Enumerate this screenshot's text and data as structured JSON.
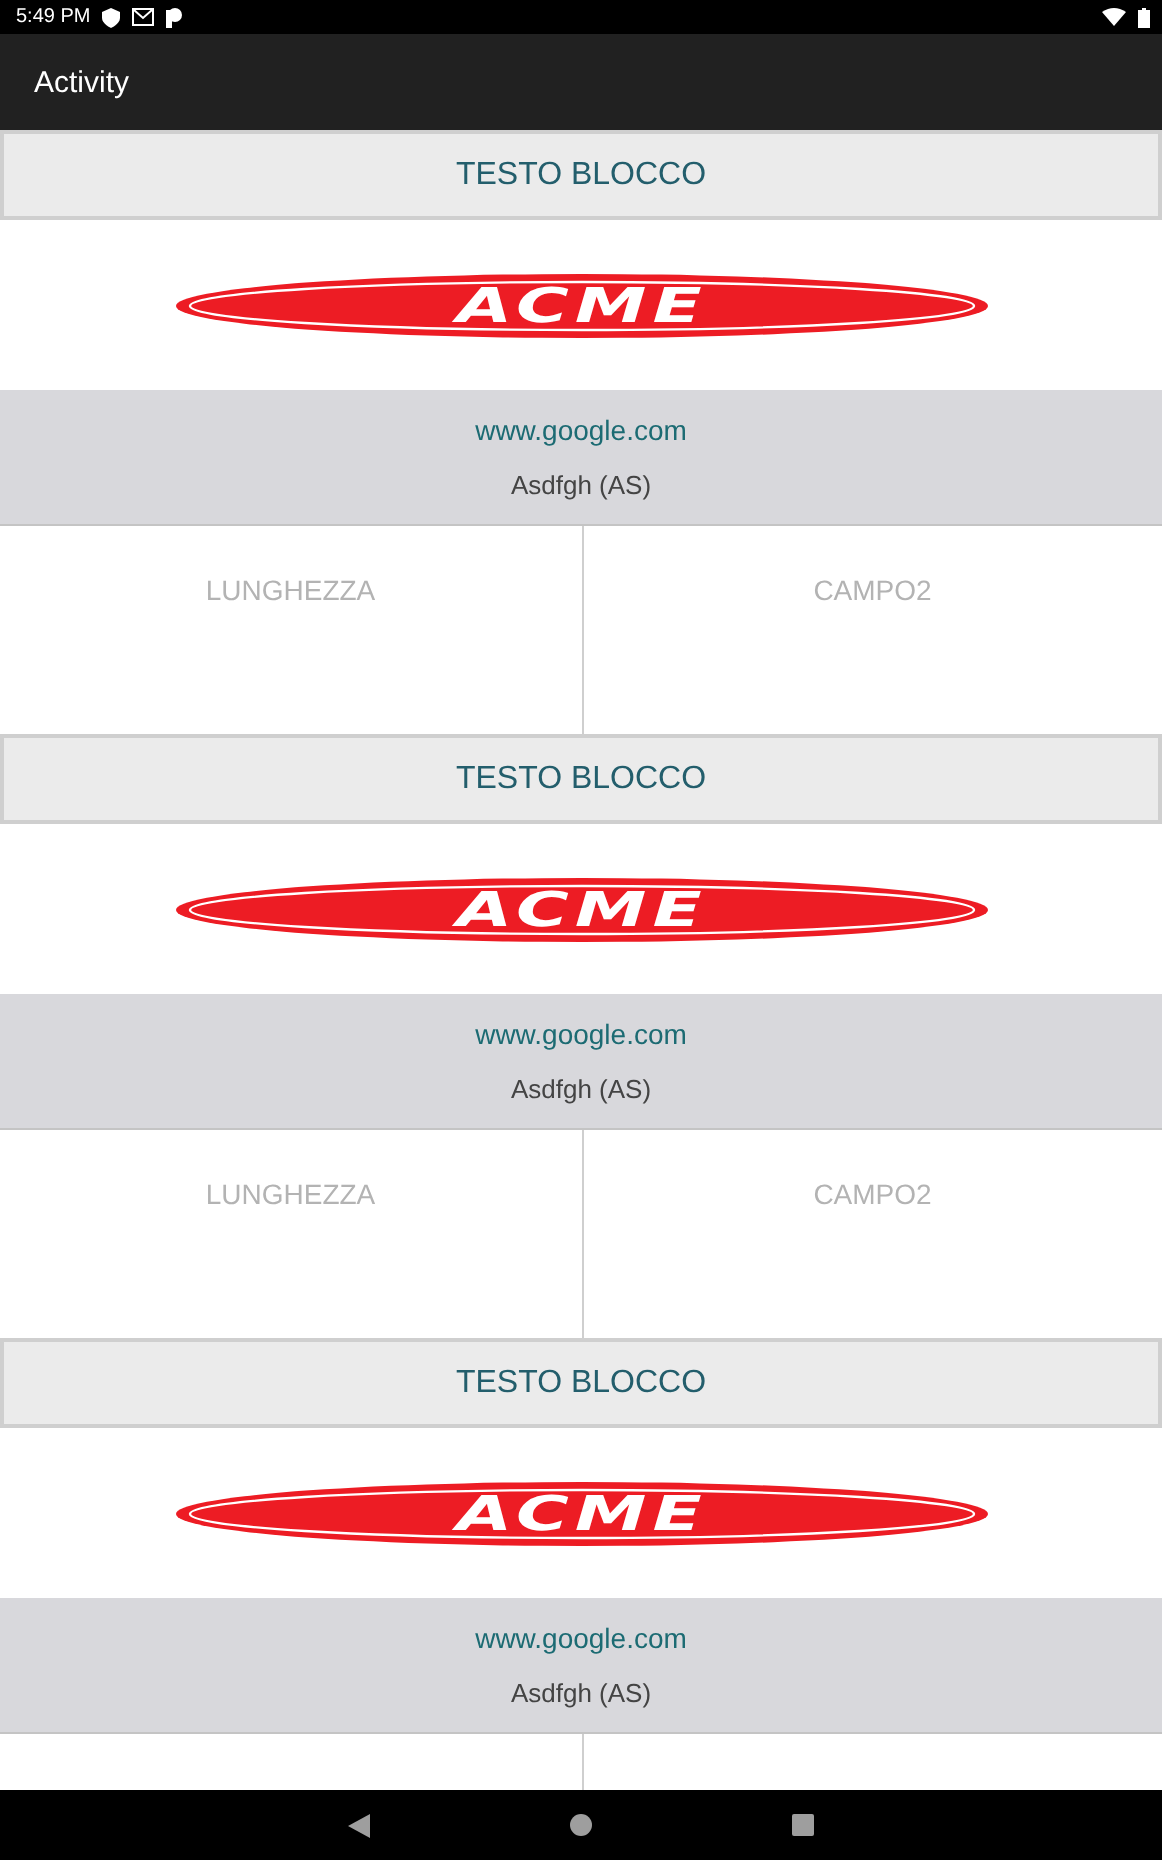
{
  "status_bar": {
    "time": "5:49 PM"
  },
  "app_bar": {
    "title": "Activity"
  },
  "blocks": [
    {
      "header": "TESTO BLOCCO",
      "logo_text": "ACME",
      "link": "www.google.com",
      "name": "Asdfgh (AS)",
      "fields": [
        "LUNGHEZZA",
        "CAMPO2"
      ]
    },
    {
      "header": "TESTO BLOCCO",
      "logo_text": "ACME",
      "link": "www.google.com",
      "name": "Asdfgh (AS)",
      "fields": [
        "LUNGHEZZA",
        "CAMPO2"
      ]
    },
    {
      "header": "TESTO BLOCCO",
      "logo_text": "ACME",
      "link": "www.google.com",
      "name": "Asdfgh (AS)"
    }
  ]
}
